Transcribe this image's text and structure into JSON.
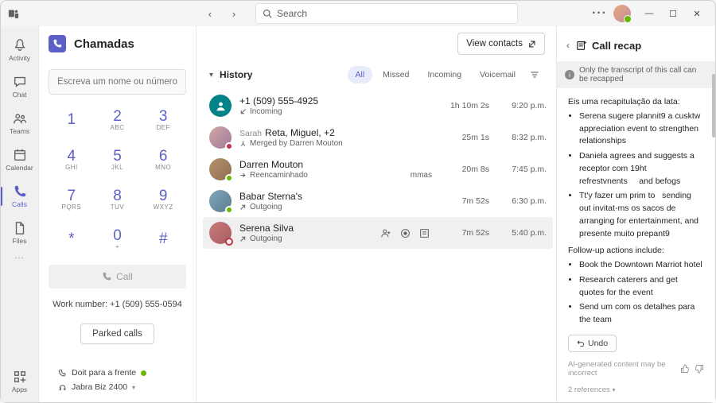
{
  "titlebar": {
    "search_placeholder": "Search"
  },
  "rail": {
    "items": [
      {
        "id": "activity",
        "label": "Activity"
      },
      {
        "id": "chat",
        "label": "Chat"
      },
      {
        "id": "teams",
        "label": "Teams"
      },
      {
        "id": "calendar",
        "label": "Calendar"
      },
      {
        "id": "calls",
        "label": "Calls"
      },
      {
        "id": "files",
        "label": "Files"
      }
    ],
    "apps": "Apps"
  },
  "calls": {
    "title": "Chamadas",
    "dial_placeholder": "Escreva um nome ou número",
    "keys": [
      {
        "n": "1",
        "s": ""
      },
      {
        "n": "2",
        "s": "ABC"
      },
      {
        "n": "3",
        "s": "DEF"
      },
      {
        "n": "4",
        "s": "GHI"
      },
      {
        "n": "5",
        "s": "JKL"
      },
      {
        "n": "6",
        "s": "MNO"
      },
      {
        "n": "7",
        "s": "PQRS"
      },
      {
        "n": "8",
        "s": "TUV"
      },
      {
        "n": "9",
        "s": "WXYZ"
      },
      {
        "n": "*",
        "s": ""
      },
      {
        "n": "0",
        "s": "+"
      },
      {
        "n": "#",
        "s": ""
      }
    ],
    "call_label": "Call",
    "work_number": "Work number: +1 (509) 555-0594",
    "parked_label": "Parked calls",
    "status_line": "Doit para a frente",
    "device_line": "Jabra Biz 2400"
  },
  "history": {
    "view_contacts": "View contacts",
    "heading": "History",
    "filters": {
      "all": "All",
      "missed": "Missed",
      "incoming": "Incoming",
      "voicemail": "Voicemail"
    },
    "rows": [
      {
        "title": "+1 (509) 555-4925",
        "sub": "Incoming",
        "dur": "1h 10m 2s",
        "time": "9:20 p.m.",
        "avatar": "teal"
      },
      {
        "title_pre": "Sarah",
        "title": "Reta, Miguel, +2",
        "sub": "Merged by Darren Mouton",
        "dur": "25m 1s",
        "time": "8:32 p.m.",
        "avatar": "p1",
        "pres": "busy",
        "merge": true
      },
      {
        "title": "Darren Mouton",
        "extra": "Reencaminhado",
        "sub": "",
        "suffix": "mmas",
        "dur": "20m 8s",
        "time": "7:45 p.m.",
        "avatar": "p2",
        "pres": "avail"
      },
      {
        "title": "Babar Sterna's",
        "sub": "Outgoing",
        "dur": "7m 52s",
        "time": "6:30 p.m.",
        "avatar": "p3",
        "pres": "avail"
      },
      {
        "title": "Serena Silva",
        "sub": "Outgoing",
        "dur": "7m 52s",
        "time": "5:40 p.m.",
        "avatar": "p4",
        "pres": "away",
        "selected": true,
        "actions": true
      }
    ]
  },
  "recap": {
    "title": "Call recap",
    "banner": "Only the transcript of this call can be recapped",
    "intro": "Eis uma recapitulação da lata:",
    "bullets1": [
      "Serena sugere plannit9 a cusktw appreciation event to strengthen relationships",
      "Daniela agrees and suggests a receptor com 19ht refrestvnents     and befogs",
      "Tt'y fazer um prim to   sending out invitat-ms os sacos de           arranging for entertainment, and presente muito prepant9"
    ],
    "follow": "Follow-up actions include:",
    "bullets2": [
      "Book the Downtown Marriot hotel",
      "Research caterers and get quotes for the event",
      "Send um com os detalhes para the team"
    ],
    "undo": "Undo",
    "disclaimer": "AI-generated content may be incorrect",
    "refs": "2 references"
  }
}
